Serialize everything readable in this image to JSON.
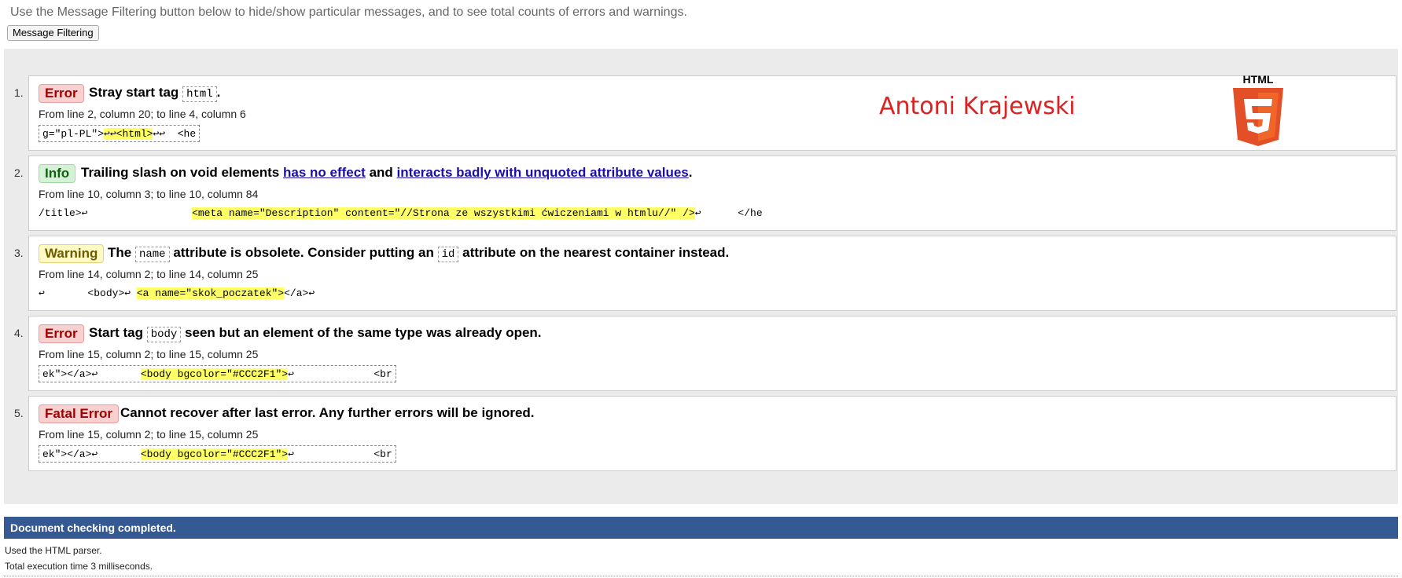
{
  "intro_text": "Use the Message Filtering button below to hide/show particular messages, and to see total counts of errors and warnings.",
  "filter_button": "Message Filtering",
  "author_name": "Antoni Krajewski",
  "html5_logo_text": "HTML",
  "messages": [
    {
      "number": "1.",
      "type": "Error",
      "headline_pre": "Stray start tag",
      "code1": "html",
      "headline_post": ".",
      "location": "From line 2, column 20; to line 4, column 6",
      "extract_before": "g=\"pl-PL\">",
      "extract_highlight": "↩↩<html>",
      "extract_after": "↩↩  <he"
    },
    {
      "number": "2.",
      "type": "Info",
      "headline_pre": "Trailing slash on void elements",
      "link1": "has no effect",
      "headline_mid": "and",
      "link2": "interacts badly with unquoted attribute values",
      "headline_post": ".",
      "location": "From line 10, column 3; to line 10, column 84",
      "extract_before": "/title>↩                 ",
      "extract_highlight": "<meta name=\"Description\" content=\"//Strona ze wszystkimi ćwiczeniami w htmlu//\" />",
      "extract_after": "↩      </he"
    },
    {
      "number": "3.",
      "type": "Warning",
      "headline_pre": "The",
      "code1": "name",
      "headline_mid": "attribute is obsolete. Consider putting an",
      "code2": "id",
      "headline_post": "attribute on the nearest container instead.",
      "location": "From line 14, column 2; to line 14, column 25",
      "extract_before": "↩       <body>↩ ",
      "extract_highlight": "<a name=\"skok_poczatek\">",
      "extract_after": "</a>↩"
    },
    {
      "number": "4.",
      "type": "Error",
      "headline_pre": "Start tag",
      "code1": "body",
      "headline_post": "seen but an element of the same type was already open.",
      "location": "From line 15, column 2; to line 15, column 25",
      "extract_before": "ek\"></a>↩       ",
      "extract_highlight": "<body bgcolor=\"#CCC2F1\">",
      "extract_after": "↩             <br"
    },
    {
      "number": "5.",
      "type": "Fatal Error",
      "headline_pre": "Cannot recover after last error. Any further errors will be ignored.",
      "location": "From line 15, column 2; to line 15, column 25",
      "extract_before": "ek\"></a>↩       ",
      "extract_highlight": "<body bgcolor=\"#CCC2F1\">",
      "extract_after": "↩             <br"
    }
  ],
  "footer": {
    "status": "Document checking completed.",
    "parser": "Used the HTML parser.",
    "time": "Total execution time 3 milliseconds."
  },
  "colors": {
    "error_badge_bg": "#f8d0d0",
    "info_badge_bg": "#d6f2d6",
    "warning_badge_bg": "#fff9c4",
    "highlight": "#ffff66",
    "footer_bar": "#355a93",
    "author_text": "#e02020",
    "html5_orange": "#e34f26"
  }
}
